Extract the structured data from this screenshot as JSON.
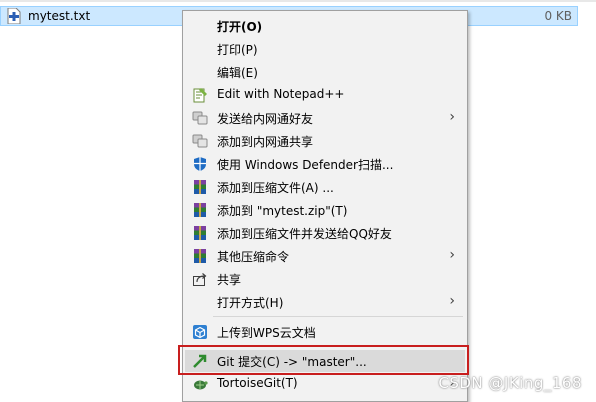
{
  "file": {
    "name": "mytest.txt",
    "size": "0 KB"
  },
  "menu": {
    "items": [
      {
        "label": "打开(O)"
      },
      {
        "label": "打印(P)"
      },
      {
        "label": "编辑(E)"
      },
      {
        "label": "Edit with Notepad++",
        "icon": "notepad-plus-plus-icon"
      },
      {
        "label": "发送给内网通好友",
        "icon": "lan-share-icon"
      },
      {
        "label": "添加到内网通共享",
        "icon": "lan-share-icon"
      },
      {
        "label": "使用 Windows Defender扫描...",
        "icon": "defender-shield-icon"
      },
      {
        "label": "添加到压缩文件(A) ...",
        "icon": "winrar-icon"
      },
      {
        "label": "添加到 \"mytest.zip\"(T)",
        "icon": "winrar-icon"
      },
      {
        "label": "添加到压缩文件并发送给QQ好友",
        "icon": "winrar-icon"
      },
      {
        "label": "其他压缩命令",
        "icon": "winrar-icon"
      },
      {
        "label": "共享",
        "icon": "share-icon"
      },
      {
        "label": "打开方式(H)"
      },
      {
        "label": "上传到WPS云文档",
        "icon": "wps-cloud-icon"
      },
      {
        "label": "Git 提交(C) -> \"master\"...",
        "icon": "git-commit-icon"
      },
      {
        "label": "TortoiseGit(T)",
        "icon": "tortoisegit-icon"
      }
    ]
  },
  "watermark": "CSDN @JKing_168",
  "colors": {
    "selection": "#cce8ff",
    "highlight_box": "#c81e1e",
    "menu_bg": "#f2f2f2"
  }
}
